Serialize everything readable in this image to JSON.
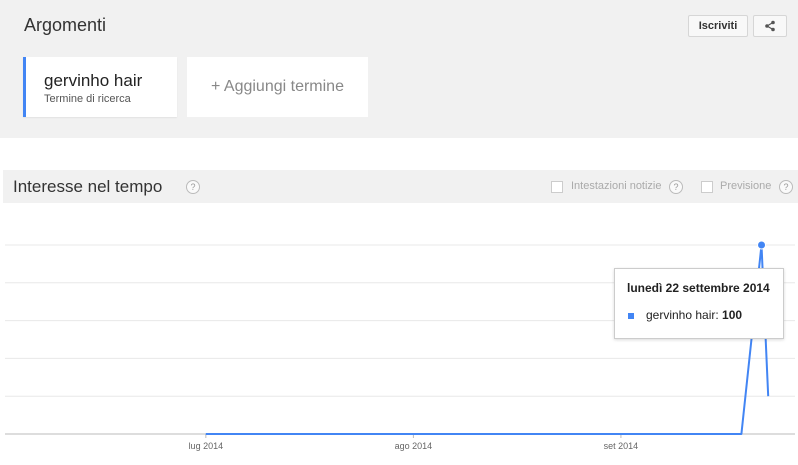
{
  "topics": {
    "title": "Argomenti",
    "subscribe_label": "Iscriviti",
    "share_icon": "share-icon",
    "term": {
      "name": "gervinho hair",
      "subtitle": "Termine di ricerca",
      "color": "#4285f4"
    },
    "add_term_label": "+ Aggiungi termine"
  },
  "interest": {
    "title": "Interesse nel tempo",
    "help": "?",
    "news_headlines_label": "Intestazioni notizie",
    "forecast_label": "Previsione"
  },
  "tooltip": {
    "date": "lunedì 22 settembre 2014",
    "series": "gervinho hair",
    "value": "100"
  },
  "chart_data": {
    "type": "line",
    "x_tick_labels": [
      "lug 2014",
      "ago 2014",
      "set 2014"
    ],
    "series": [
      {
        "name": "gervinho hair",
        "color": "#4285f4",
        "points": [
          {
            "x": "2014-07-01",
            "y": 0
          },
          {
            "x": "2014-09-19",
            "y": 0
          },
          {
            "x": "2014-09-22",
            "y": 100
          },
          {
            "x": "2014-09-23",
            "y": 20
          }
        ]
      }
    ],
    "ylim": [
      0,
      100
    ],
    "grid": true,
    "highlight": {
      "x": "2014-09-22",
      "y": 100
    }
  }
}
